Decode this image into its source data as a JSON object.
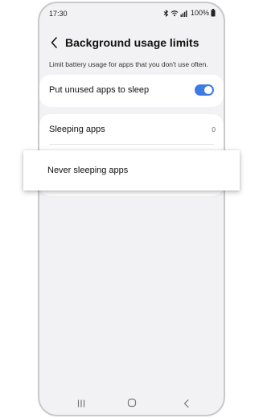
{
  "status_bar": {
    "time": "17:30",
    "battery": "100%",
    "icons": [
      "bluetooth-icon",
      "wifi-icon",
      "signal-icon",
      "battery-icon"
    ]
  },
  "header": {
    "title": "Background usage limits",
    "back_icon": "chevron-left-icon"
  },
  "description": "Limit battery usage for apps that you don't use often.",
  "settings": {
    "put_unused_to_sleep": {
      "label": "Put unused apps to sleep",
      "enabled": true
    },
    "sleeping_apps": {
      "label": "Sleeping apps",
      "count": "0"
    },
    "never_sleeping_apps": {
      "label": "Never sleeping apps"
    }
  },
  "nav_bar": {
    "icons": [
      "recents-icon",
      "home-icon",
      "back-icon"
    ]
  },
  "colors": {
    "accent": "#3e7be5",
    "background": "#f2f2f4",
    "card": "#ffffff"
  }
}
